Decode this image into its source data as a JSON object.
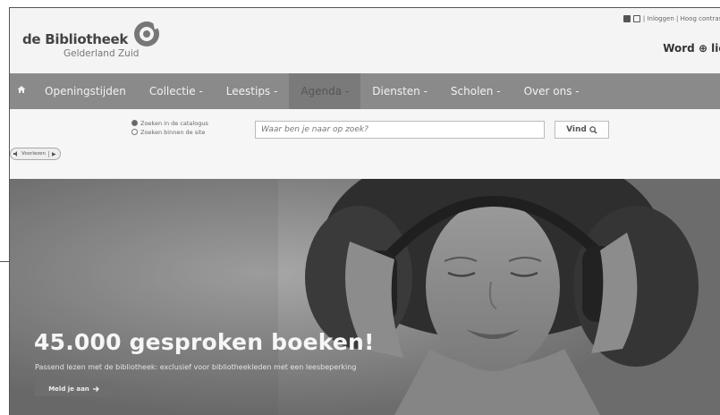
{
  "header": {
    "logo_main": "de Bibliotheek",
    "logo_sub": "Gelderland Zuid",
    "toplinks": "| Inloggen | Hoog contrast",
    "word_link": "Word ⊕ lid"
  },
  "nav": {
    "items": [
      {
        "label": "Openingstijden"
      },
      {
        "label": "Collectie -"
      },
      {
        "label": "Leestips -"
      },
      {
        "label": "Agenda -"
      },
      {
        "label": "Diensten -"
      },
      {
        "label": "Scholen -"
      },
      {
        "label": "Over ons -"
      }
    ]
  },
  "search": {
    "option_catalogus": "Zoeken in de catalogus",
    "option_site": "Zoeken binnen de site",
    "placeholder": "Waar ben je naar op zoek?",
    "button": "Vind"
  },
  "voorlezen": {
    "label": "Voorlezen",
    "play": "▶"
  },
  "hero": {
    "title": "45.000 gesproken boeken!",
    "subtitle": "Passend lezen met de bibliotheek: exclusief voor bibliotheekleden met een leesbeperking",
    "button": "Meld je aan"
  },
  "colors": {
    "nav_bg": "#8a8a8a",
    "header_bg": "#f4f4f4",
    "hero_bg": "#8a8a8a"
  }
}
